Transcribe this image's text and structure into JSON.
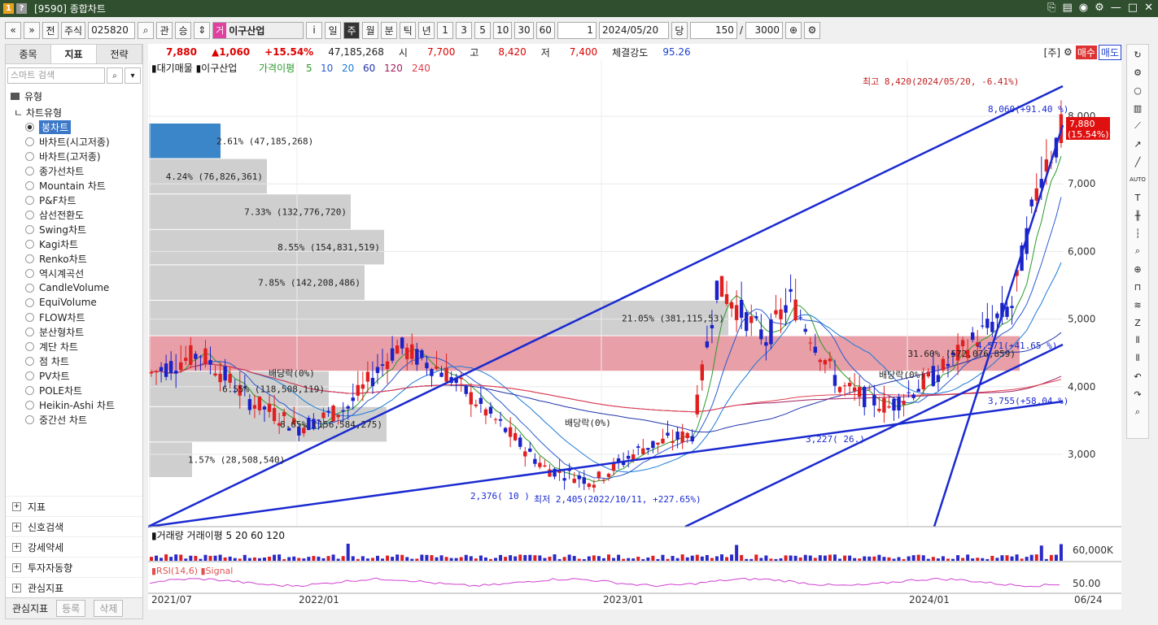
{
  "window": {
    "title": "[9590] 종합차트",
    "badges": [
      "1",
      "?"
    ]
  },
  "toolbar": {
    "market": "전",
    "type": "주식",
    "code": "025820",
    "prefix_a": "관",
    "prefix_b": "승",
    "market_badge": "거",
    "stock_name": "이구산업",
    "periods": [
      "일",
      "주",
      "월",
      "분",
      "틱",
      "년"
    ],
    "active_period": "주",
    "counts": [
      "1",
      "3",
      "5",
      "10",
      "30",
      "60"
    ],
    "unit": "1",
    "date": "2024/05/20",
    "dang": "당",
    "bars": "150",
    "total": "3000"
  },
  "left": {
    "tabs": [
      "종목",
      "지표",
      "전략"
    ],
    "active_tab": "지표",
    "search_placeholder": "스마트 검색",
    "category": "유형",
    "subcategory": "차트유형",
    "chart_types": [
      "봉차트",
      "바차트(시고저종)",
      "바차트(고저종)",
      "종가선차트",
      "Mountain 차트",
      "P&F차트",
      "삼선전환도",
      "Swing차트",
      "Kagi차트",
      "Renko차트",
      "역시계곡선",
      "CandleVolume",
      "EquiVolume",
      "FLOW차트",
      "분산형차트",
      "계단 차트",
      "점 차트",
      "PV차트",
      "POLE차트",
      "Heikin-Ashi 차트",
      "중간선 차트"
    ],
    "selected": "봉차트",
    "groups": [
      "지표",
      "신호검색",
      "강세약세",
      "투자자동향",
      "관심지표"
    ],
    "footer": {
      "label": "관심지표",
      "register": "등록",
      "delete": "삭제"
    }
  },
  "info": {
    "price": "7,880",
    "change": "▲1,060",
    "rate": "+15.54%",
    "volume": "47,185,268",
    "open_label": "시",
    "open": "7,700",
    "high_label": "고",
    "high": "8,420",
    "low_label": "저",
    "low": "7,400",
    "strength_label": "체결강도",
    "strength": "95.26",
    "unit_tag": "[주]",
    "buy": "매수",
    "sell": "매도"
  },
  "chart": {
    "legend": {
      "vp": "대기매물",
      "name": "이구산업",
      "ma_label": "가격이평",
      "ma": [
        "5",
        "10",
        "20",
        "60",
        "120",
        "240"
      ]
    },
    "y_ticks": [
      "8,000",
      "7,000",
      "6,000",
      "5,000",
      "4,000",
      "3,000"
    ],
    "x_ticks": [
      "2021/07",
      "2022/01",
      "2023/01",
      "2024/01"
    ],
    "current_label": "7,880",
    "current_rate": "(15.54%)",
    "annotations": {
      "high": "최고 8,420(2024/05/20, -6.41%)",
      "low": "최저 2,405(2022/10/11, +227.65%)",
      "t1": "8,060(+91.40 %)",
      "t2": "4,571(+41.65 %)",
      "t3": "3,755(+58.04 %)",
      "t4": "3,227( 26.)",
      "t5": "2,376( 10 )",
      "div1": "배당락(0%)",
      "div2": "배당락(0%)",
      "div3": "배당락(0%)"
    },
    "volume_profile": [
      {
        "label": "2.61% (47,185,268)",
        "w": 88,
        "hl": "blue"
      },
      {
        "label": "4.24% (76,826,361)",
        "w": 145,
        "hl": ""
      },
      {
        "label": "7.33% (132,776,720)",
        "w": 248,
        "hl": ""
      },
      {
        "label": "8.55% (154,831,519)",
        "w": 289,
        "hl": ""
      },
      {
        "label": "7.85% (142,208,486)",
        "w": 265,
        "hl": ""
      },
      {
        "label": "21.05% (381,115,53)",
        "w": 712,
        "hl": ""
      },
      {
        "label": "31.60% (572,076,859)",
        "w": 1070,
        "hl": "red"
      },
      {
        "label": "6.55% (118,508,119)",
        "w": 221,
        "hl": ""
      },
      {
        "label": "8.65% (156,584,275)",
        "w": 292,
        "hl": ""
      },
      {
        "label": "1.57% (28,508,540)",
        "w": 53,
        "hl": ""
      }
    ],
    "volume_legend": {
      "label": "거래량",
      "ma_label": "거래이평",
      "ma": [
        "5",
        "20",
        "60",
        "120"
      ],
      "tick": "60,000K"
    },
    "rsi_legend": {
      "label": "RSI(14,6)",
      "signal": "Signal",
      "tick": "50.00"
    },
    "end_date": "06/24"
  }
}
